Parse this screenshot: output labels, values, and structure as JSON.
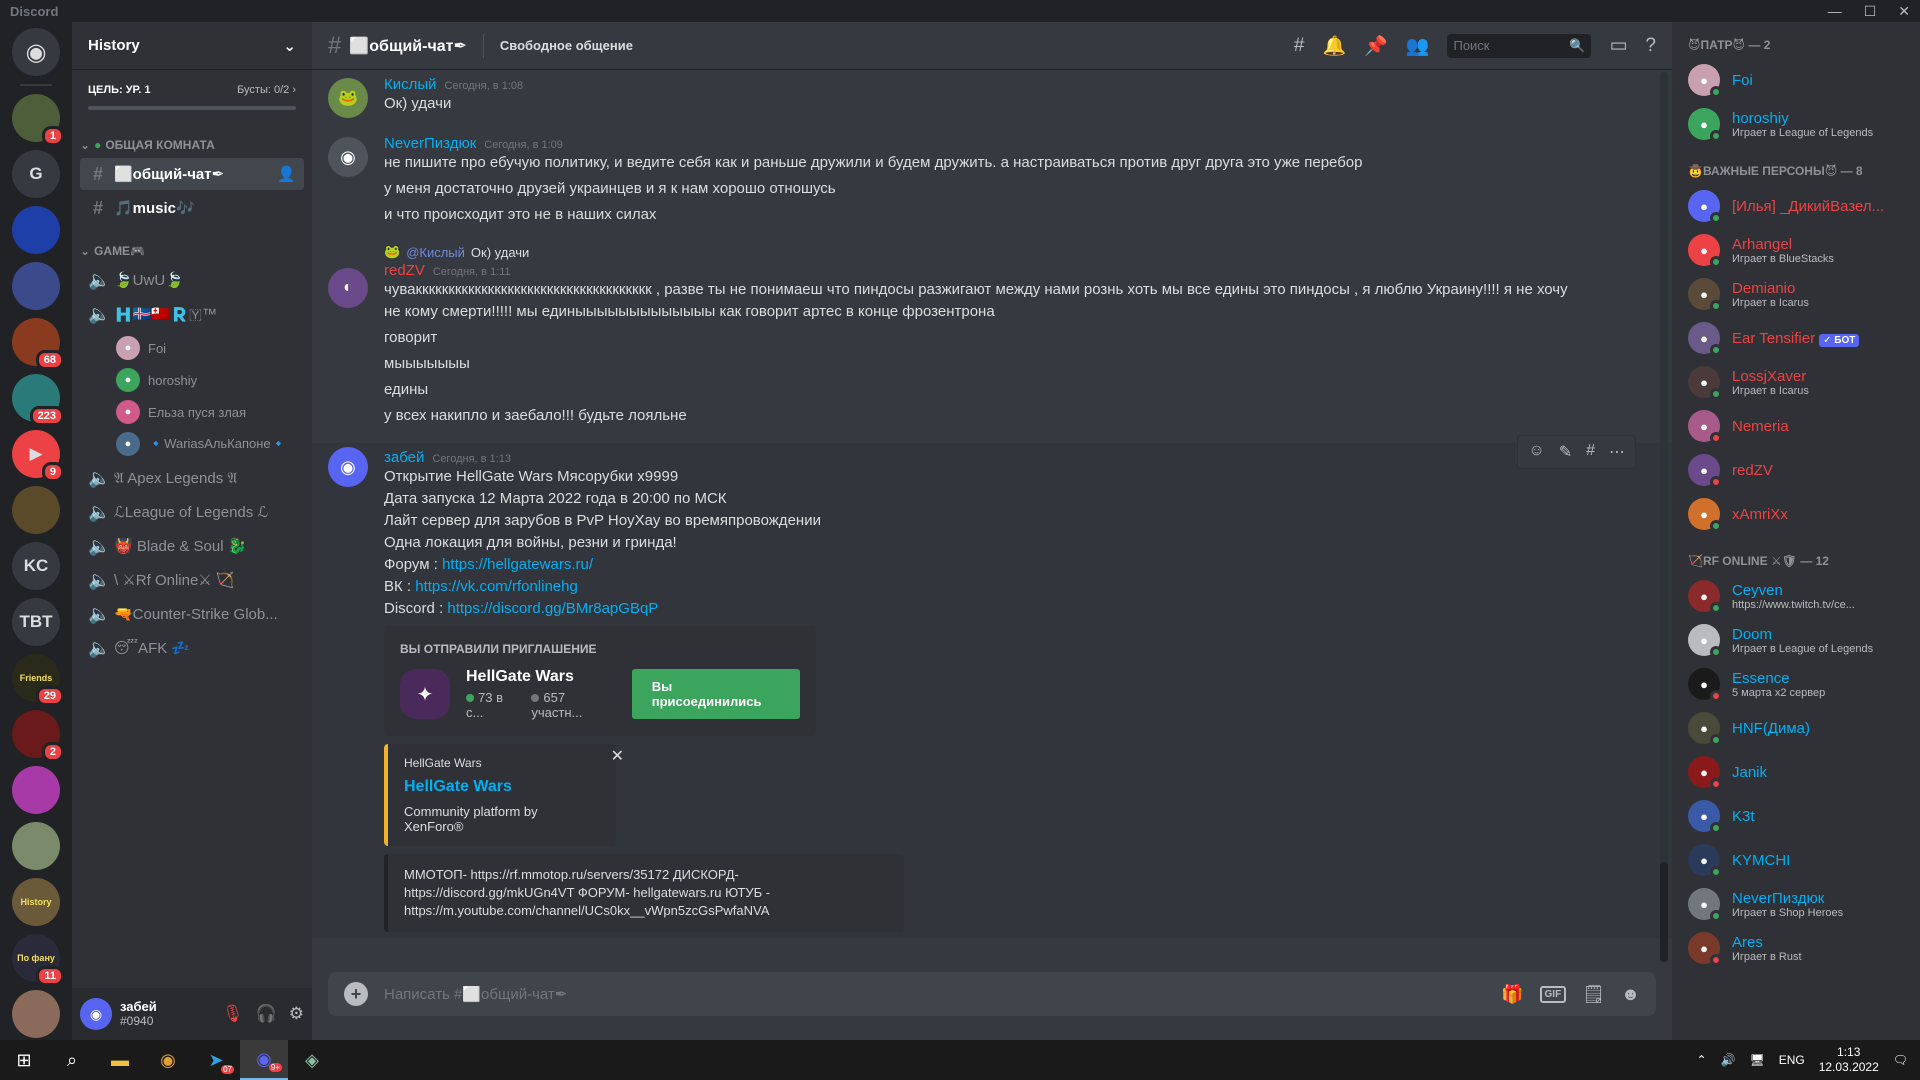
{
  "app": {
    "title": "Discord",
    "window_controls": [
      "—",
      "☐",
      "✕"
    ]
  },
  "servers": [
    {
      "label": "",
      "icon": "discord-home-icon",
      "color": "#36393f",
      "badge": ""
    },
    {
      "label": "",
      "icon": "server-avatar",
      "color": "#4e5d3a",
      "badge": "1"
    },
    {
      "label": "G",
      "icon": "",
      "color": "#36393f",
      "badge": ""
    },
    {
      "label": "",
      "icon": "envyus-icon",
      "color": "#1f3fa8",
      "badge": ""
    },
    {
      "label": "",
      "icon": "server-avatar",
      "color": "#3a4a8a",
      "badge": ""
    },
    {
      "label": "",
      "icon": "server-avatar",
      "color": "#8a3a1f",
      "badge": "68"
    },
    {
      "label": "",
      "icon": "server-avatar",
      "color": "#2a7a7a",
      "badge": "223"
    },
    {
      "label": "▶",
      "icon": "play-icon",
      "color": "#ed4245",
      "badge": "9"
    },
    {
      "label": "",
      "icon": "server-avatar",
      "color": "#5a4a2a",
      "badge": ""
    },
    {
      "label": "KC",
      "icon": "",
      "color": "#36393f",
      "badge": ""
    },
    {
      "label": "TBT",
      "icon": "",
      "color": "#36393f",
      "badge": ""
    },
    {
      "label": "Friends",
      "icon": "",
      "color": "#2a2a1a",
      "badge": "29"
    },
    {
      "label": "",
      "icon": "server-avatar",
      "color": "#6a1a1a",
      "badge": "2"
    },
    {
      "label": "",
      "icon": "server-avatar",
      "color": "#a83aa8",
      "badge": ""
    },
    {
      "label": "",
      "icon": "server-avatar",
      "color": "#7a8a6a",
      "badge": ""
    },
    {
      "label": "History",
      "icon": "",
      "color": "#6a5a3a",
      "badge": ""
    },
    {
      "label": "По фану",
      "icon": "",
      "color": "#2a2a3a",
      "badge": "11"
    },
    {
      "label": "",
      "icon": "server-avatar",
      "color": "#8a6a5a",
      "badge": ""
    }
  ],
  "guild": {
    "name": "History",
    "boost_goal": "ЦЕЛЬ: УР. 1",
    "boosts": "Бусты: 0/2"
  },
  "categories": {
    "general": "ОБЩАЯ КОМНАТА",
    "game": "GAME🎮"
  },
  "text_channels": [
    {
      "name": "⬜общий-чат✒",
      "active": true
    },
    {
      "name": "🎵music🎶",
      "active": false
    }
  ],
  "voice_channels_top": [
    {
      "name": "🍃UwU🍃"
    },
    {
      "name": "🇭🇮🇸🇹🇴🇷🇾™"
    }
  ],
  "voice_users": [
    {
      "name": "Foi",
      "color": "#c9a0b0"
    },
    {
      "name": "horoshiy",
      "color": "#3ba55d"
    },
    {
      "name": "Ельза пуся злая",
      "color": "#d05a8a"
    },
    {
      "name": "🔹WariasАльКапоне🔹",
      "color": "#4a6a8a"
    }
  ],
  "voice_channels_bottom": [
    {
      "name": "𝔄 Apex Legends 𝔄"
    },
    {
      "name": "ℒLeague of Legends ℒ"
    },
    {
      "name": "👹 Blade & Soul 🐉"
    },
    {
      "name": "\\ ⚔Rf Online⚔ 🏹"
    },
    {
      "name": "🔫Counter-Strike Glob..."
    },
    {
      "name": "😴AFK 💤"
    }
  ],
  "user": {
    "name": "забей",
    "tag": "#0940"
  },
  "channel": {
    "name": "⬜общий-чат✒",
    "topic": "Свободное общение"
  },
  "search": {
    "placeholder": "Поиск"
  },
  "messages": {
    "m1": {
      "author": "Кислый",
      "color": "#00aff4",
      "time": "Сегодня, в 1:08",
      "lines": [
        "Ок) удачи"
      ]
    },
    "m2": {
      "author": "NeverПиздюк",
      "color": "#00aff4",
      "time": "Сегодня, в 1:09",
      "lines": [
        "не пишите про ебучую политику, и ведите себя как и раньше дружили и будем дружить. а настраиваться против друг друга это уже перебор",
        "у меня достаточно друзей украинцев и я к нам хорошо отношусь",
        "и что происходит это не в наших силах"
      ]
    },
    "m3": {
      "reply_mention": "@Кислый",
      "reply_text": "Ок) удачи",
      "author": "redZV",
      "color": "#ed4245",
      "time": "Сегодня, в 1:11",
      "lines": [
        "чувакккккккккккккккккккккккккккккккккккк , разве ты не понимаеш что пиндосы разжигают между  нами рознь хоть мы все едины это пиндосы , я люблю  Украину!!!! я не хочу",
        "не кому смерти!!!!! мы единыыыыыыыыыыыыы  как говорит  артес  в конце фрозентрона",
        "говорит",
        "мыыыыыыы",
        "едины",
        "у всех накипло и заебало!!! будьте  лояльне"
      ]
    },
    "m4": {
      "author": "забей",
      "color": "#00aff4",
      "time": "Сегодня, в 1:13",
      "lines": [
        "Открытие HellGate Wars Мясорубки x9999",
        "Дата запуска 12 Марта 2022 года в 20:00 по МСК",
        "Лайт сервер для зарубов в PvP HoyXay во времяпровождении",
        "Одна локация для войны, резни и гринда!"
      ],
      "forum_label": "Форум : ",
      "forum_link": "https://hellgatewars.ru/",
      "vk_label": "ВК : ",
      "vk_link": "https://vk.com/rfonlinehg",
      "discord_label": "Discord : ",
      "discord_link": "https://discord.gg/BMr8apGBqP"
    }
  },
  "invite": {
    "title": "ВЫ ОТПРАВИЛИ ПРИГЛАШЕНИЕ",
    "guild": "HellGate Wars",
    "online": "73 в с...",
    "members": "657 участн...",
    "button": "Вы присоединились"
  },
  "embed": {
    "provider": "HellGate Wars",
    "title": "HellGate Wars",
    "description": "Community platform by XenForo®"
  },
  "embed2": {
    "text": "ММОТОП- https://rf.mmotop.ru/servers/35172 ДИСКОРД- https://discord.gg/mkUGn4VT ФОРУМ- hellgatewars.ru ЮТУБ - https://m.youtube.com/channel/UCs0kx__vWpn5zcGsPwfaNVA"
  },
  "composer": {
    "placeholder": "Написать #⬜общий-чат✒"
  },
  "member_groups": [
    {
      "title": "😈ПАТР😈 — 2",
      "members": [
        {
          "name": "Foi",
          "activity": "",
          "color": "#00aff4",
          "av": "#c9a0b0",
          "status": "#3ba55d",
          "bot": ""
        },
        {
          "name": "horoshiy",
          "activity": "Играет в League of Legends",
          "color": "#00aff4",
          "av": "#3ba55d",
          "status": "#3ba55d",
          "bot": ""
        }
      ]
    },
    {
      "title": "🤠ВАЖНЫЕ ПЕРСОНЫ😈 — 8",
      "members": [
        {
          "name": "[Илья] _ДикийВазел...",
          "activity": "",
          "color": "#ed4245",
          "av": "#5865f2",
          "status": "#3ba55d",
          "bot": ""
        },
        {
          "name": "Arhangel",
          "activity": "Играет в BlueStacks",
          "color": "#ed4245",
          "av": "#ed4245",
          "status": "#3ba55d",
          "bot": ""
        },
        {
          "name": "Demianio",
          "activity": "Играет в Icarus",
          "color": "#ed4245",
          "av": "#5a4a3a",
          "status": "#3ba55d",
          "bot": ""
        },
        {
          "name": "Ear Tensifier",
          "activity": "",
          "color": "#ed4245",
          "av": "#6a5a8a",
          "status": "#3ba55d",
          "bot": "✓ БОТ"
        },
        {
          "name": "LossjXaver",
          "activity": "Играет в Icarus",
          "color": "#ed4245",
          "av": "#4a3a3a",
          "status": "#3ba55d",
          "bot": ""
        },
        {
          "name": "Nemeria",
          "activity": "",
          "color": "#ed4245",
          "av": "#a85a8a",
          "status": "#ed4245",
          "bot": ""
        },
        {
          "name": "redZV",
          "activity": "",
          "color": "#ed4245",
          "av": "#6a4a8a",
          "status": "#ed4245",
          "bot": ""
        },
        {
          "name": "xAmriXx",
          "activity": "",
          "color": "#ed4245",
          "av": "#d0702a",
          "status": "#3ba55d",
          "bot": ""
        }
      ]
    },
    {
      "title": "🏹RF ONLINE ⚔🛡 — 12",
      "members": [
        {
          "name": "Ceyven",
          "activity": "https://www.twitch.tv/ce...",
          "color": "#00aff4",
          "av": "#8a2a2a",
          "status": "#3ba55d",
          "bot": ""
        },
        {
          "name": "Doom",
          "activity": "Играет в League of Legends",
          "color": "#00aff4",
          "av": "#b9bbbe",
          "status": "#3ba55d",
          "bot": ""
        },
        {
          "name": "Essence",
          "activity": "5 марта x2 сервер",
          "color": "#00aff4",
          "av": "#1a1a1a",
          "status": "#ed4245",
          "bot": ""
        },
        {
          "name": "HNF(Дима)",
          "activity": "",
          "color": "#00aff4",
          "av": "#4a4a3a",
          "status": "#3ba55d",
          "bot": ""
        },
        {
          "name": "Janik",
          "activity": "",
          "color": "#00aff4",
          "av": "#8a1a1a",
          "status": "#ed4245",
          "bot": ""
        },
        {
          "name": "K3t",
          "activity": "",
          "color": "#00aff4",
          "av": "#3a5aa8",
          "status": "#3ba55d",
          "bot": ""
        },
        {
          "name": "KYMCHI",
          "activity": "",
          "color": "#00aff4",
          "av": "#2a3a5a",
          "status": "#3ba55d",
          "bot": ""
        },
        {
          "name": "NeverПиздюк",
          "activity": "Играет в Shop Heroes",
          "color": "#00aff4",
          "av": "#72767d",
          "status": "#3ba55d",
          "bot": ""
        },
        {
          "name": "Ares",
          "activity": "Играет в Rust",
          "color": "#00aff4",
          "av": "#7a3a2a",
          "status": "#ed4245",
          "bot": ""
        }
      ]
    }
  ],
  "taskbar": {
    "lang": "ENG",
    "time": "1:13",
    "date": "12.03.2022",
    "telegram_badge": "07",
    "discord_badge": "9+"
  }
}
